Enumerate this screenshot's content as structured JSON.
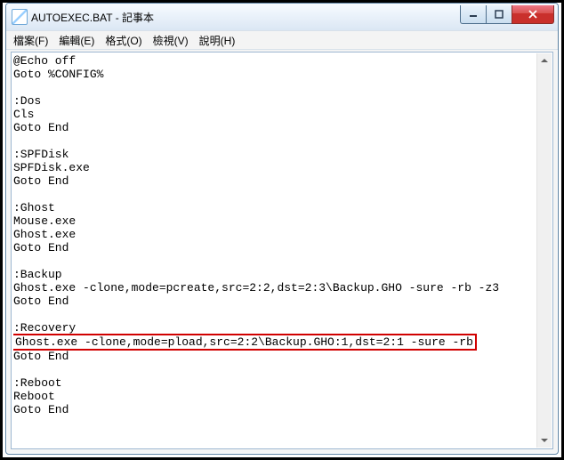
{
  "window": {
    "title": "AUTOEXEC.BAT - 記事本"
  },
  "menu": {
    "file": "檔案(F)",
    "edit": "編輯(E)",
    "format": "格式(O)",
    "view": "檢視(V)",
    "help": "說明(H)"
  },
  "content": {
    "l01": "@Echo off",
    "l02": "Goto %CONFIG%",
    "l03": "",
    "l04": ":Dos",
    "l05": "Cls",
    "l06": "Goto End",
    "l07": "",
    "l08": ":SPFDisk",
    "l09": "SPFDisk.exe",
    "l10": "Goto End",
    "l11": "",
    "l12": ":Ghost",
    "l13": "Mouse.exe",
    "l14": "Ghost.exe",
    "l15": "Goto End",
    "l16": "",
    "l17": ":Backup",
    "l18": "Ghost.exe -clone,mode=pcreate,src=2:2,dst=2:3\\Backup.GHO -sure -rb -z3",
    "l19": "Goto End",
    "l20": "",
    "l21": ":Recovery",
    "l22": "Ghost.exe -clone,mode=pload,src=2:2\\Backup.GHO:1,dst=2:1 -sure -rb",
    "l23": "Goto End",
    "l24": "",
    "l25": ":Reboot",
    "l26": "Reboot",
    "l27": "Goto End"
  },
  "icons": {
    "minimize": "minimize-icon",
    "maximize": "maximize-icon",
    "close": "close-icon"
  }
}
